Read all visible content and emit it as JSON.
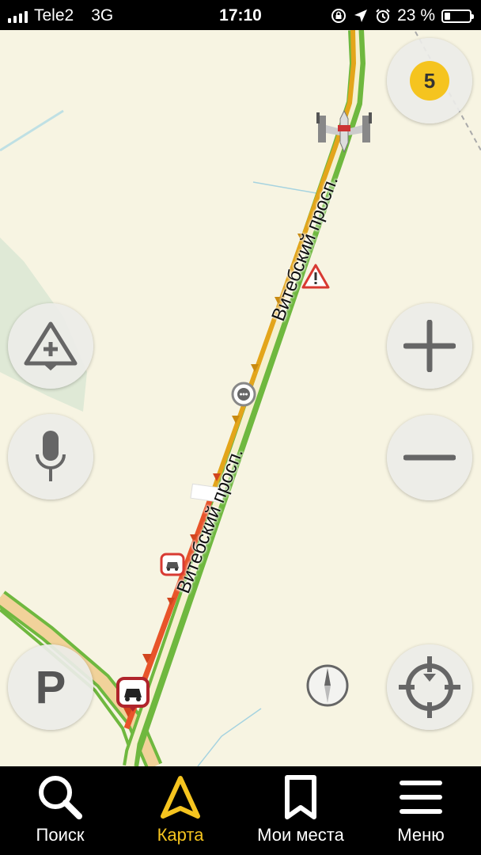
{
  "status_bar": {
    "carrier": "Tele2",
    "network": "3G",
    "time": "17:10",
    "battery": "23 %",
    "battery_level": 0.23
  },
  "map": {
    "road_labels": [
      "Витебский просп.",
      "Витебский просп."
    ],
    "traffic_level": "5",
    "colors": {
      "background": "#f7f4e2",
      "road_free": "#6fb83f",
      "road_slow": "#e3a51b",
      "road_jam": "#e8542a",
      "traffic_badge": "#f5c41f"
    },
    "controls": {
      "add_event_icon": "warning-plus-icon",
      "voice_icon": "microphone-icon",
      "parking_icon": "parking-icon",
      "parking_letter": "P",
      "zoom_in_icon": "plus-icon",
      "zoom_out_icon": "minus-icon",
      "compass_icon": "compass-icon",
      "locate_icon": "crosshair-icon"
    }
  },
  "bottom_nav": {
    "items": [
      {
        "label": "Поиск",
        "icon": "search-icon"
      },
      {
        "label": "Карта",
        "icon": "navigation-arrow-icon",
        "active": true
      },
      {
        "label": "Мои места",
        "icon": "bookmark-icon"
      },
      {
        "label": "Меню",
        "icon": "menu-icon"
      }
    ]
  }
}
